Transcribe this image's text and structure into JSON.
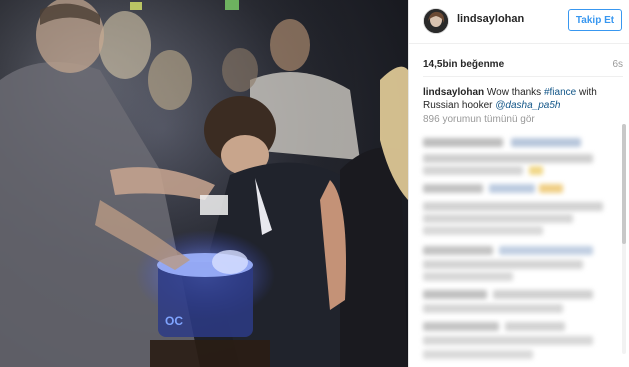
{
  "post": {
    "username": "lindsaylohan",
    "follow_label": "Takip Et",
    "likes": "14,5bin beğenme",
    "time_ago": "6s",
    "caption": {
      "user": "lindsaylohan",
      "text_1": " Wow thanks ",
      "hashtag": "#fiance",
      "text_2": " with Russian hooker ",
      "mention": "@dasha_pa5h"
    },
    "view_all_comments": "896 yorumun tümünü gör"
  },
  "colors": {
    "accent": "#3897f0",
    "link": "#125688",
    "muted": "#999999"
  }
}
